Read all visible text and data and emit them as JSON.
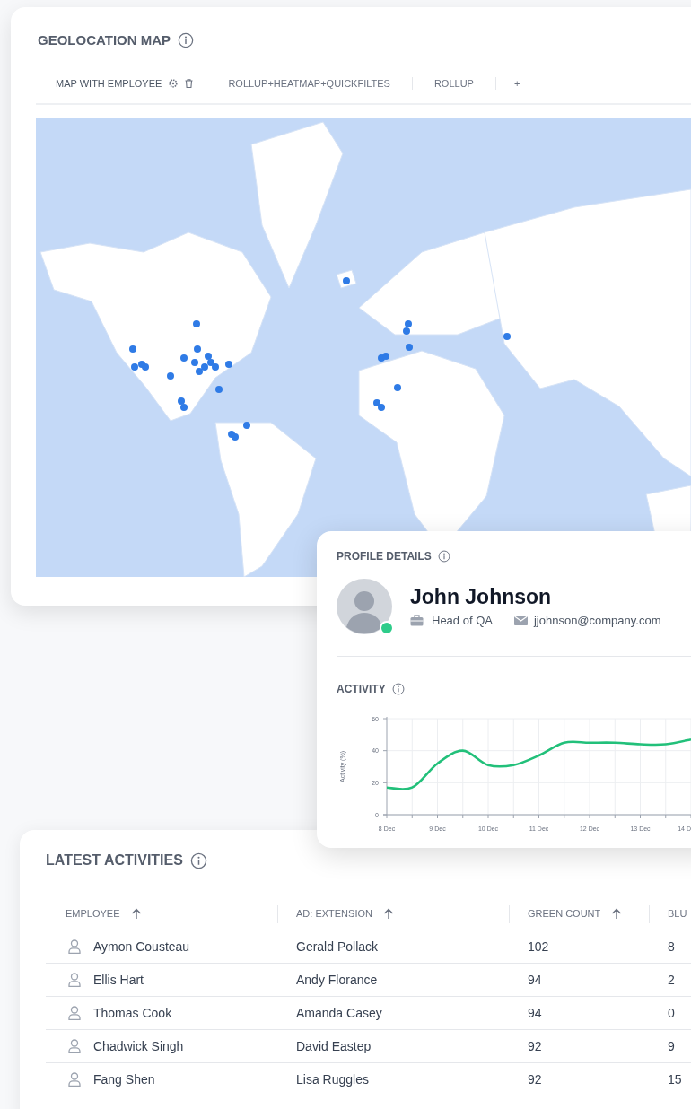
{
  "map_card": {
    "title": "GEOLOCATION MAP",
    "tabs": [
      {
        "label": "MAP WITH EMPLOYEE",
        "selected": true
      },
      {
        "label": "ROLLUP+HEATMAP+QUICKFILTES",
        "selected": false
      },
      {
        "label": "ROLLUP",
        "selected": false
      }
    ],
    "add_tab": "+"
  },
  "profile_card": {
    "title": "PROFILE DETAILS",
    "name": "John Johnson",
    "online": true,
    "role": "Head of QA",
    "email": "jjohnson@company.com",
    "activity_title": "ACTIVITY",
    "chart_data": {
      "type": "line",
      "ylabel": "Activity (%)",
      "categories": [
        "8 Dec",
        null,
        "9 Dec",
        null,
        "10 Dec",
        null,
        "11 Dec",
        null,
        "12 Dec",
        null,
        "13 Dec",
        null,
        "14 D"
      ],
      "series": [
        {
          "color": "#22c07a",
          "values": [
            17,
            17,
            32,
            40,
            31,
            31,
            37,
            45,
            45,
            45,
            44,
            44,
            47
          ]
        }
      ],
      "ylim": [
        0,
        60
      ],
      "yticks": [
        0,
        20,
        40,
        60
      ],
      "grid": true
    }
  },
  "activities_card": {
    "title": "LATEST ACTIVITIES",
    "columns": [
      {
        "label": "EMPLOYEE",
        "sortable": true
      },
      {
        "label": "AD: EXTENSION",
        "sortable": true
      },
      {
        "label": "GREEN COUNT",
        "sortable": true
      },
      {
        "label": "BLU",
        "sortable": false
      }
    ],
    "rows": [
      [
        "Aymon Cousteau",
        "Gerald Pollack",
        "102",
        "8"
      ],
      [
        "Ellis Hart",
        "Andy Florance",
        "94",
        "2"
      ],
      [
        "Thomas Cook",
        "Amanda Casey",
        "94",
        "0"
      ],
      [
        "Chadwick Singh",
        "David Eastep",
        "92",
        "9"
      ],
      [
        "Fang Shen",
        "Lisa Ruggles",
        "92",
        "15"
      ]
    ]
  }
}
